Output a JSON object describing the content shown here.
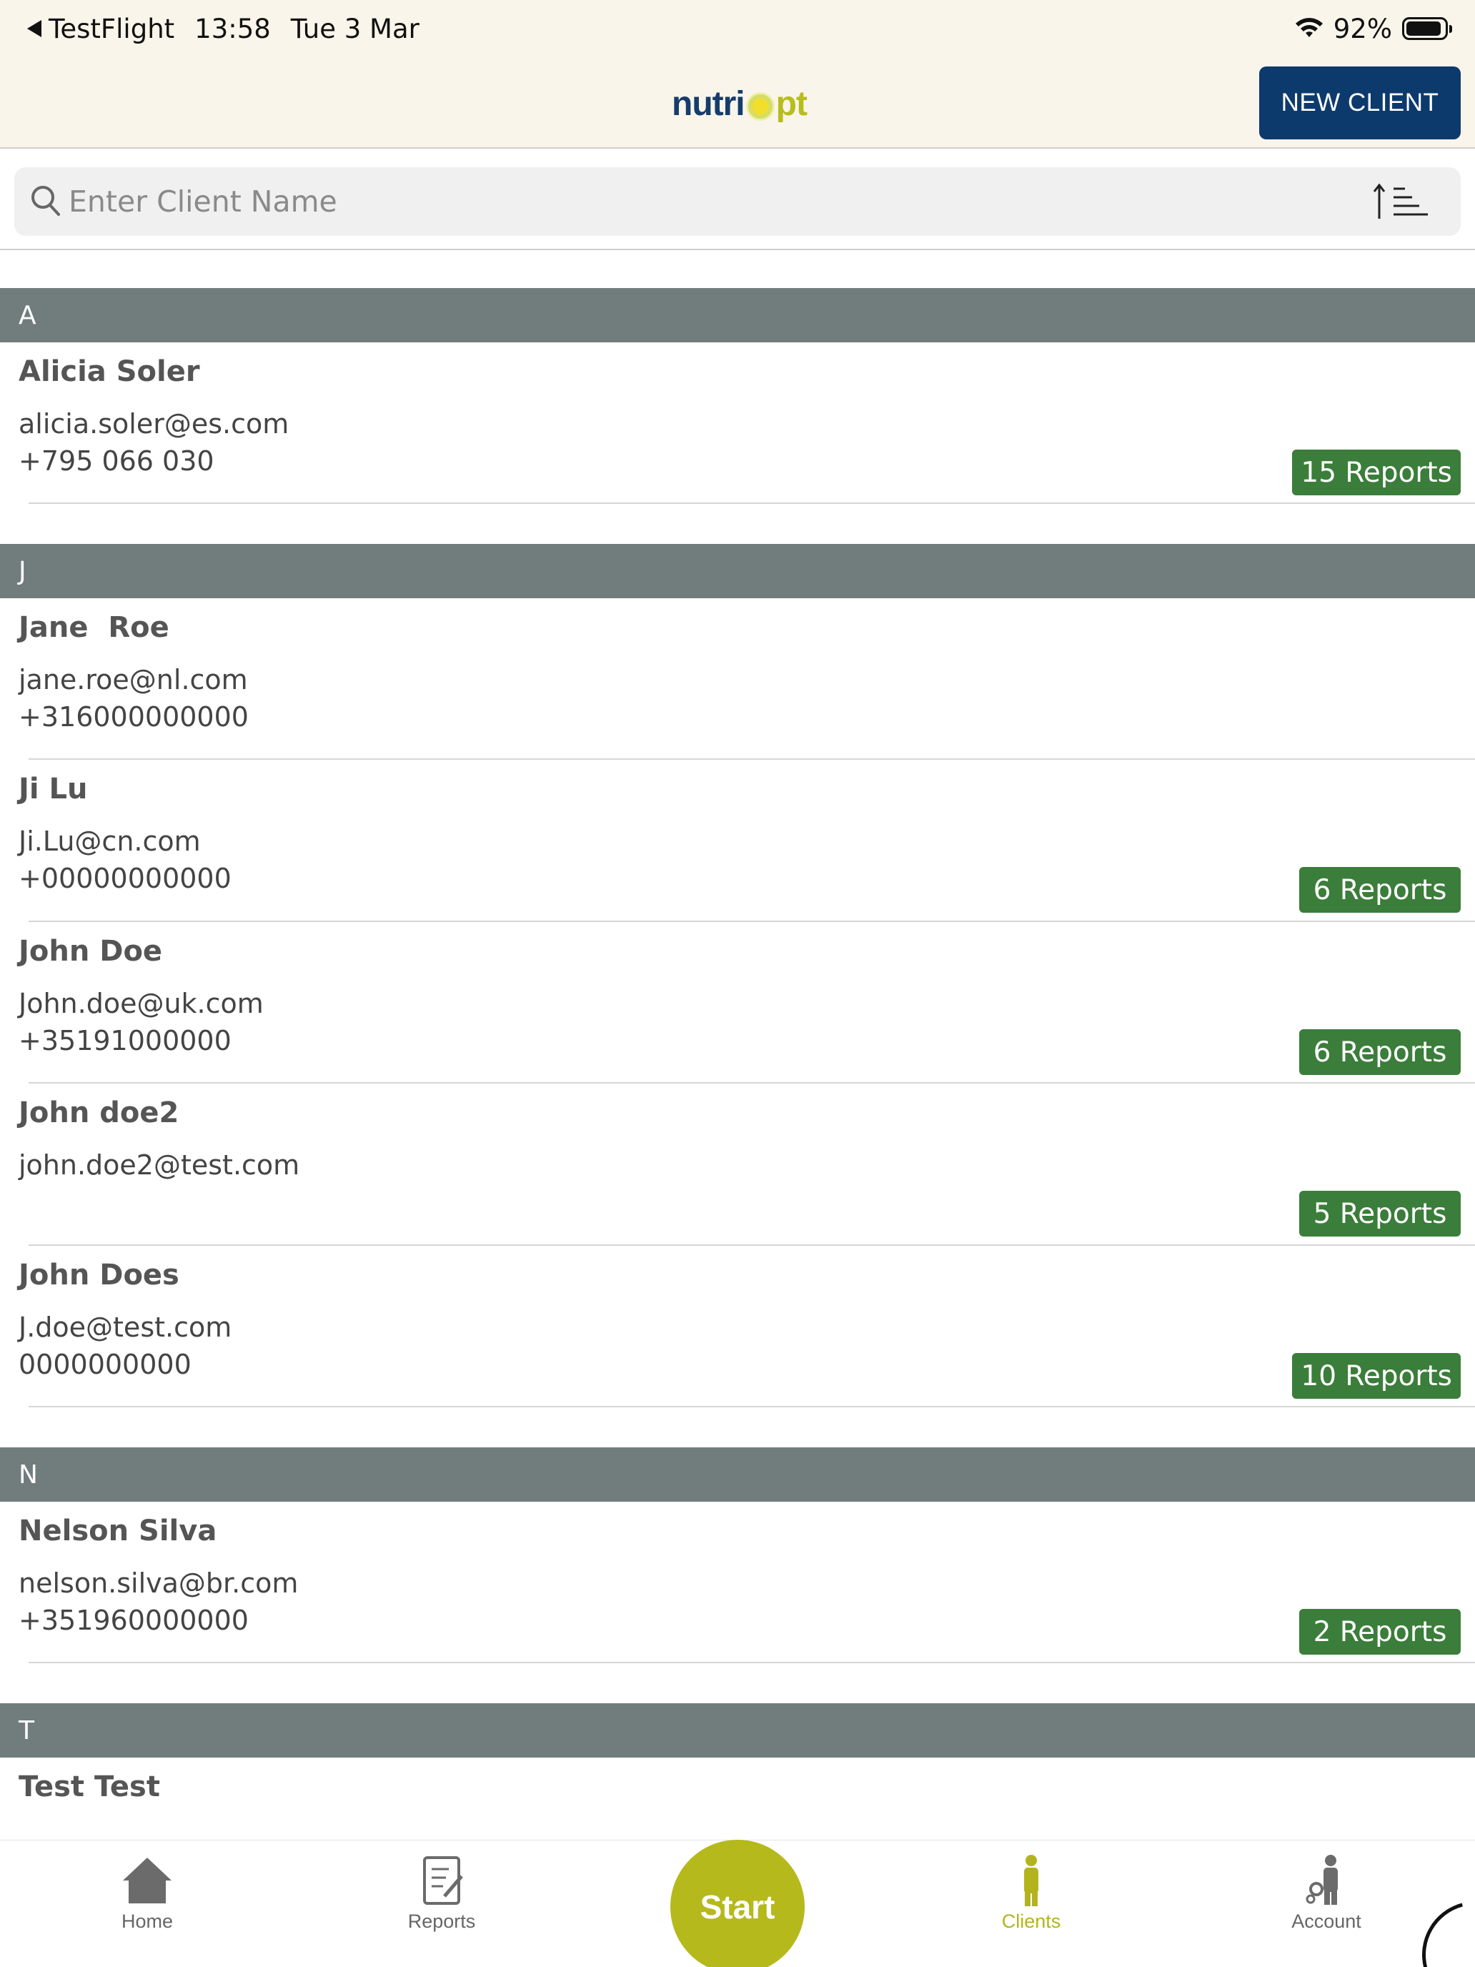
{
  "status_bar": {
    "back_app": "TestFlight",
    "time": "13:58",
    "date": "Tue 3 Mar",
    "battery": "92%",
    "battery_level": 0.92
  },
  "header": {
    "logo_part1": "nutri",
    "logo_part2": "pt",
    "new_client_label": "NEW CLIENT"
  },
  "search": {
    "placeholder": "Enter Client Name",
    "value": ""
  },
  "sections": [
    {
      "letter": "A"
    },
    {
      "letter": "J"
    },
    {
      "letter": "N"
    },
    {
      "letter": "T"
    }
  ],
  "clients": [
    {
      "name": "Alicia Soler",
      "email": "alicia.soler@es.com",
      "phone": "+795 066 030",
      "reports": "15 Reports"
    },
    {
      "name": "Jane  Roe",
      "email": "jane.roe@nl.com",
      "phone": "+316000000000",
      "reports": ""
    },
    {
      "name": "Ji Lu",
      "email": "Ji.Lu@cn.com",
      "phone": "+00000000000",
      "reports": "6 Reports"
    },
    {
      "name": "John Doe",
      "email": "John.doe@uk.com",
      "phone": "+35191000000",
      "reports": "6 Reports"
    },
    {
      "name": "John doe2",
      "email": "john.doe2@test.com",
      "phone": "",
      "reports": "5 Reports"
    },
    {
      "name": "John Does",
      "email": "J.doe@test.com",
      "phone": "0000000000",
      "reports": "10 Reports"
    },
    {
      "name": "Nelson Silva",
      "email": "nelson.silva@br.com",
      "phone": "+351960000000",
      "reports": "2 Reports"
    },
    {
      "name": "Test Test",
      "email": "",
      "phone": "",
      "reports": ""
    }
  ],
  "tab_bar": {
    "home": "Home",
    "reports": "Reports",
    "start": "Start",
    "clients": "Clients",
    "account": "Account",
    "active": "clients"
  },
  "colors": {
    "brand_navy": "#0d3a6d",
    "brand_lime": "#b5b91c",
    "section_header": "#717d7c",
    "report_badge": "#3b7d3a"
  }
}
